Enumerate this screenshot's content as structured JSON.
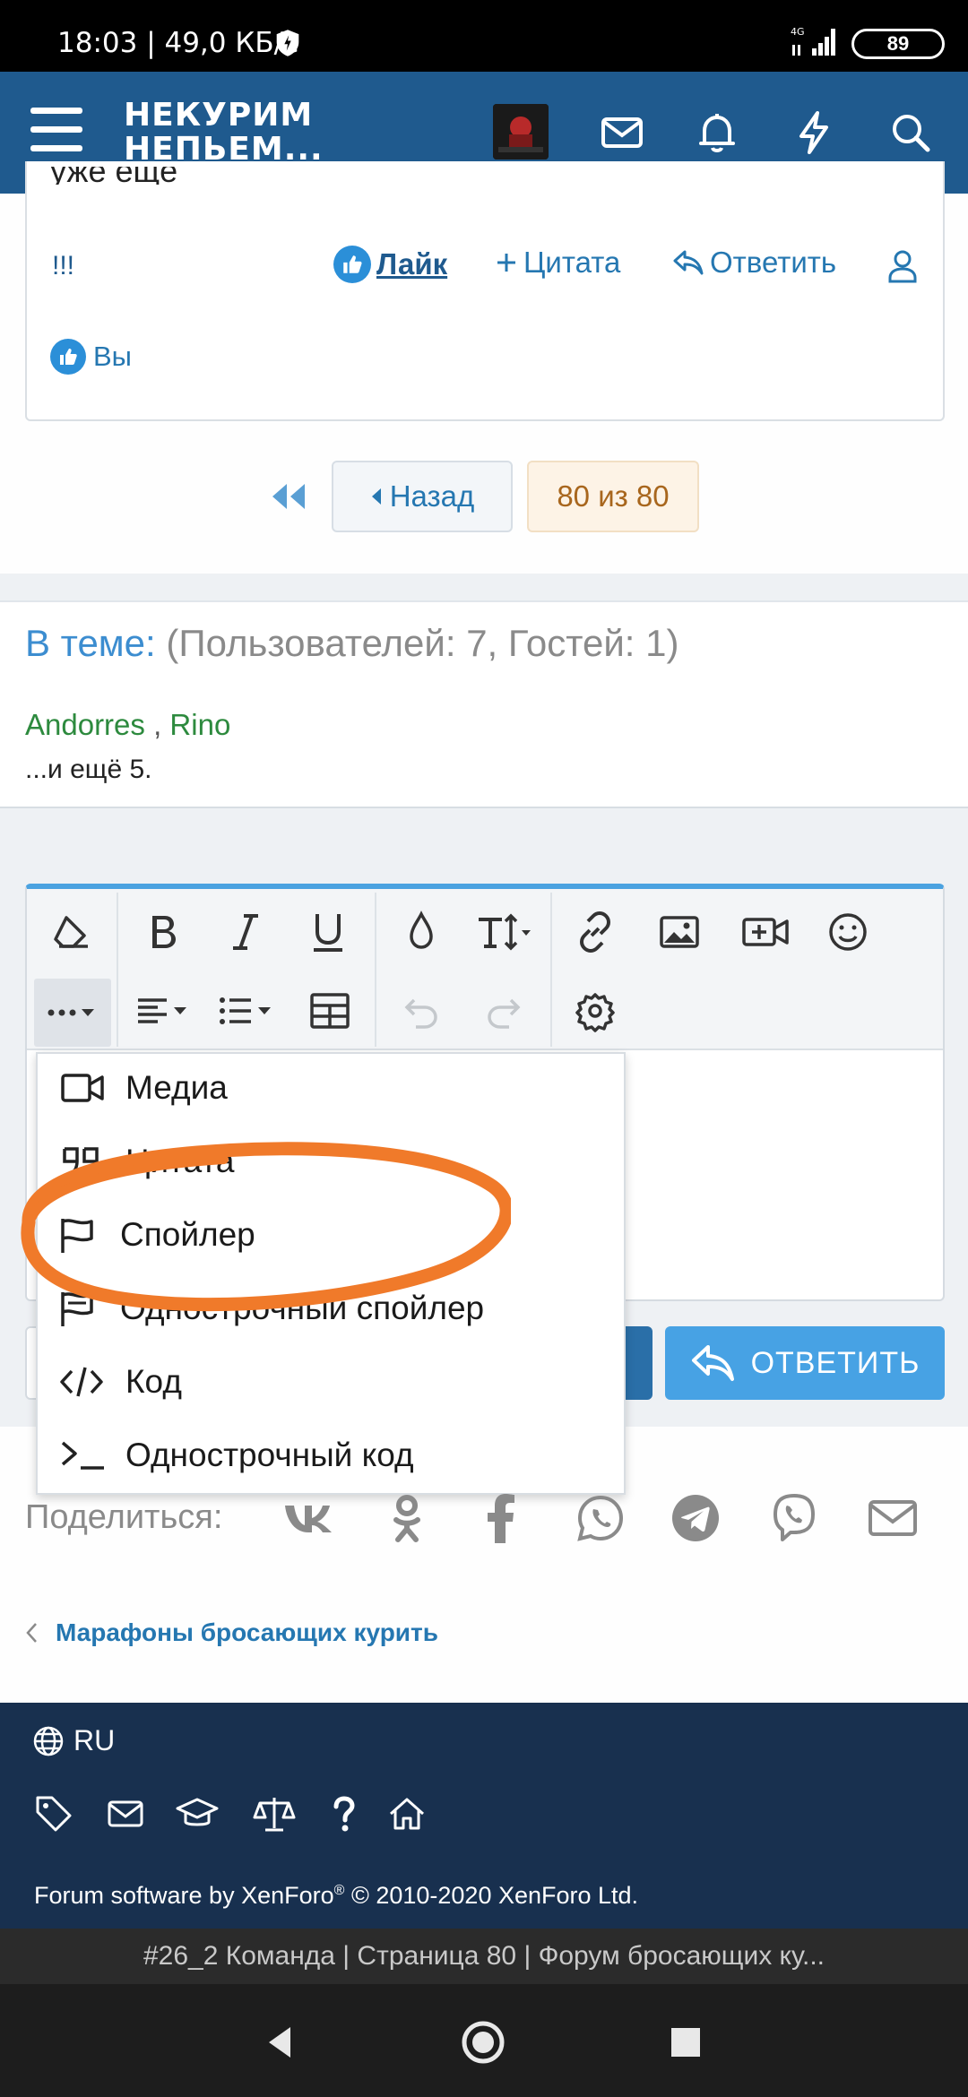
{
  "status_bar": {
    "time_speed": "18:03 | 49,0 КБ/с",
    "network": "4G",
    "battery": "89"
  },
  "header": {
    "logo_line1": "НЕКУРИМ",
    "logo_line2": "НЕПЬЕМ..."
  },
  "post": {
    "cut_text": "уже ещё",
    "exclamation": "!!!",
    "like_label": "Лайк",
    "quote_label": "Цитата",
    "reply_label": "Ответить",
    "reacted_user": "Вы"
  },
  "pagination": {
    "back_label": "Назад",
    "current": "80 из 80"
  },
  "online": {
    "heading": "В теме:",
    "counts": "(Пользователей: 7, Гостей: 1)",
    "users": [
      "Andorres",
      "Rino"
    ],
    "separator": ",",
    "more": "...и ещё 5."
  },
  "menu": {
    "items": [
      {
        "label": "Медиа",
        "icon": "video-icon"
      },
      {
        "label": "Цитата",
        "icon": "quote-icon"
      },
      {
        "label": "Спойлер",
        "icon": "flag-icon"
      },
      {
        "label": "Однострочный спойлер",
        "icon": "flag-inline-icon"
      },
      {
        "label": "Код",
        "icon": "code-icon"
      },
      {
        "label": "Однострочный код",
        "icon": "terminal-icon"
      }
    ]
  },
  "editor": {
    "reply_button": "ОТВЕТИТЬ"
  },
  "share": {
    "label": "Поделиться:",
    "icons": [
      "vk-icon",
      "odnoklassniki-icon",
      "facebook-icon",
      "whatsapp-icon",
      "telegram-icon",
      "viber-icon",
      "email-icon"
    ]
  },
  "breadcrumb": {
    "label": "Марафоны бросающих курить"
  },
  "footer": {
    "language": "RU",
    "copyright": "Forum software by XenForo",
    "copyright_tail": " © 2010-2020 XenForo Ltd.",
    "registered": "®"
  },
  "browser": {
    "page_title": "#26_2 Команда | Страница 80 | Форум бросающих ку..."
  },
  "colors": {
    "header_bg": "#1f5a8e",
    "accent": "#47a2e4",
    "annotation": "#f07a2a",
    "footer_bg": "#18304f"
  }
}
